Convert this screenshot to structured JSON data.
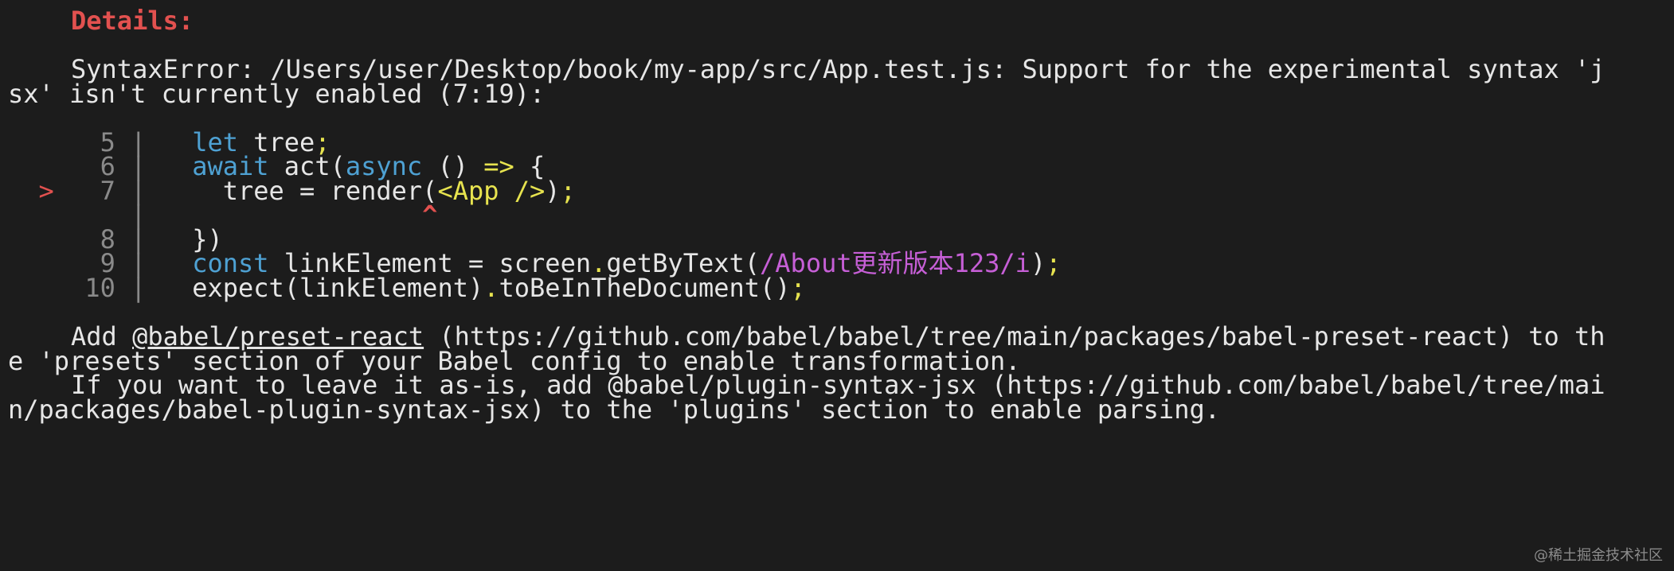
{
  "details_label": "Details:",
  "error_line_1": "SyntaxError: /Users/user/Desktop/book/my-app/src/App.test.js: Support for the experimental syntax 'j",
  "error_line_2": "sx' isn't currently enabled (7:19):",
  "code": {
    "l5_num": "5",
    "l6_num": "6",
    "l7_num": "7",
    "l8_num": "8",
    "l9_num": "9",
    "l10_num": "10",
    "bar": "|",
    "marker": ">",
    "caret": "^",
    "l5_kw": "let",
    "l5_rest": "tree",
    "l5_semi": ";",
    "l6_kw1": "await",
    "l6_mid": "act(",
    "l6_kw2": "async",
    "l6_paren": "()",
    "l6_arrow": "=>",
    "l6_brace": "{",
    "l7_a": "tree = render(",
    "l7_tag": "<App />",
    "l7_b": ")",
    "l7_semi": ";",
    "l8": "})",
    "l9_kw": "const",
    "l9_a": "linkElement = screen",
    "l9_dot": ".",
    "l9_b": "getByText(",
    "l9_regex": "/About更新版本123/i",
    "l9_c": ")",
    "l9_semi": ";",
    "l10_a": "expect(linkElement)",
    "l10_dot": ".",
    "l10_b": "toBeInTheDocument()",
    "l10_semi": ";"
  },
  "add_line_1_pre": "Add ",
  "add_line_1_link": "@babel/preset-react",
  "add_line_1_post": " (https://github.com/babel/babel/tree/main/packages/babel-preset-react) to th",
  "add_line_2": "e 'presets' section of your Babel config to enable transformation.",
  "leave_line_1": "If you want to leave it as-is, add @babel/plugin-syntax-jsx (https://github.com/babel/babel/tree/mai",
  "leave_line_2": "n/packages/babel-plugin-syntax-jsx) to the 'plugins' section to enable parsing.",
  "watermark": "@稀土掘金技术社区"
}
